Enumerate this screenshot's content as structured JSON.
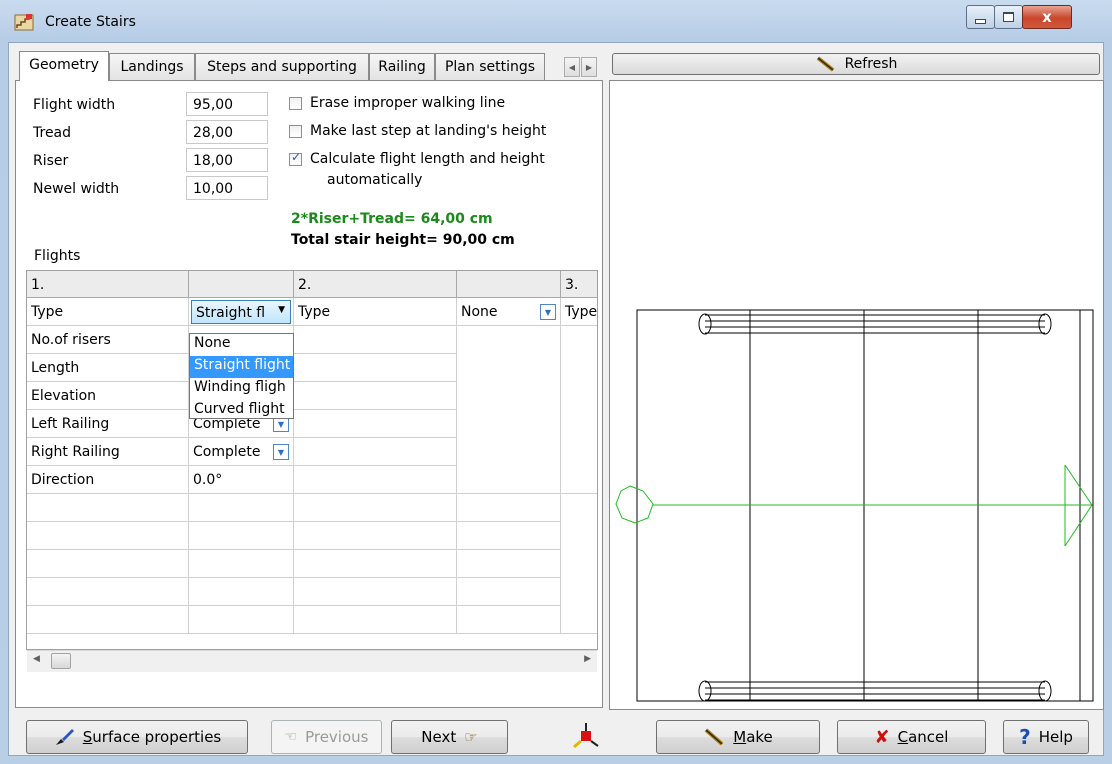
{
  "window": {
    "title": "Create Stairs",
    "minimize": "–",
    "maximize": "▢",
    "close": "x"
  },
  "tabs": [
    {
      "label": "Geometry"
    },
    {
      "label": "Landings"
    },
    {
      "label": "Steps and supporting"
    },
    {
      "label": "Railing"
    },
    {
      "label": "Plan settings"
    }
  ],
  "geometry": {
    "flight_width_label": "Flight width",
    "flight_width": "95,00",
    "tread_label": "Tread",
    "tread": "28,00",
    "riser_label": "Riser",
    "riser": "18,00",
    "newel_width_label": "Newel width",
    "newel_width": "10,00",
    "erase_label": "Erase improper walking line",
    "last_step_label": "Make last step at landing's height",
    "calc_label_1": "Calculate flight length and height",
    "calc_label_2": "automatically",
    "formula": "2*Riser+Tread= 64,00 cm",
    "total_height": "Total stair height= 90,00 cm"
  },
  "flights": {
    "label": "Flights",
    "headers": [
      "1.",
      "",
      "2.",
      "",
      "3."
    ],
    "rows": [
      {
        "name": "Type",
        "value": "Straight fl",
        "c2": "Type",
        "c3": "None",
        "c4": "Type"
      },
      {
        "name": "No.of risers",
        "value": ""
      },
      {
        "name": "Length",
        "value": ""
      },
      {
        "name": "Elevation",
        "value": ""
      },
      {
        "name": "Left Railing",
        "value": "Complete"
      },
      {
        "name": "Right Railing",
        "value": "Complete"
      },
      {
        "name": "Direction",
        "value": "0.0°"
      }
    ],
    "type_options": [
      "None",
      "Straight flight",
      "Winding fligh",
      "Curved flight"
    ],
    "selected_option": "Straight flight"
  },
  "buttons": {
    "refresh": "Refresh",
    "surface_accel": "S",
    "surface_rest": "urface properties",
    "previous": "Previous",
    "next": "Next",
    "make_accel": "M",
    "make_rest": "ake",
    "cancel_accel": "C",
    "cancel_rest": "ancel",
    "help": "Help"
  },
  "colors": {
    "walking_line": "#22bb22",
    "formula": "#1a8a1a",
    "selection": "#3399ff"
  }
}
